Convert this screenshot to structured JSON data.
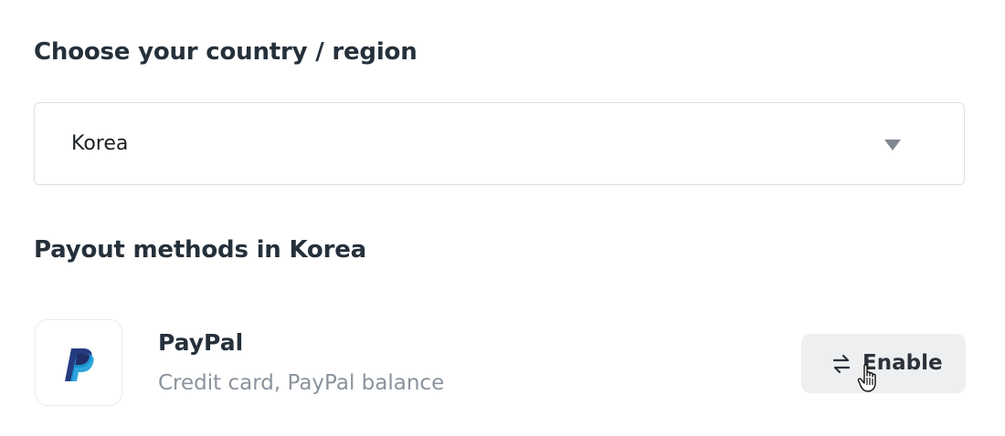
{
  "country_section": {
    "heading": "Choose your country / region",
    "selected_country": "Korea",
    "caret_icon": "caret-down-icon"
  },
  "payout_section": {
    "heading": "Payout methods in Korea",
    "methods": [
      {
        "logo_icon": "paypal-logo-icon",
        "name": "PayPal",
        "description": "Credit card, PayPal balance",
        "action_icon": "swap-arrows-icon",
        "action_label": "Enable"
      }
    ]
  },
  "colors": {
    "heading_text": "#25303b",
    "secondary_text": "#8a939c",
    "button_bg": "#eeeff1",
    "border": "#dcdfe3",
    "paypal_dark": "#253b80",
    "paypal_light": "#179bd7"
  },
  "cursor_icon": "hand-pointer-icon"
}
